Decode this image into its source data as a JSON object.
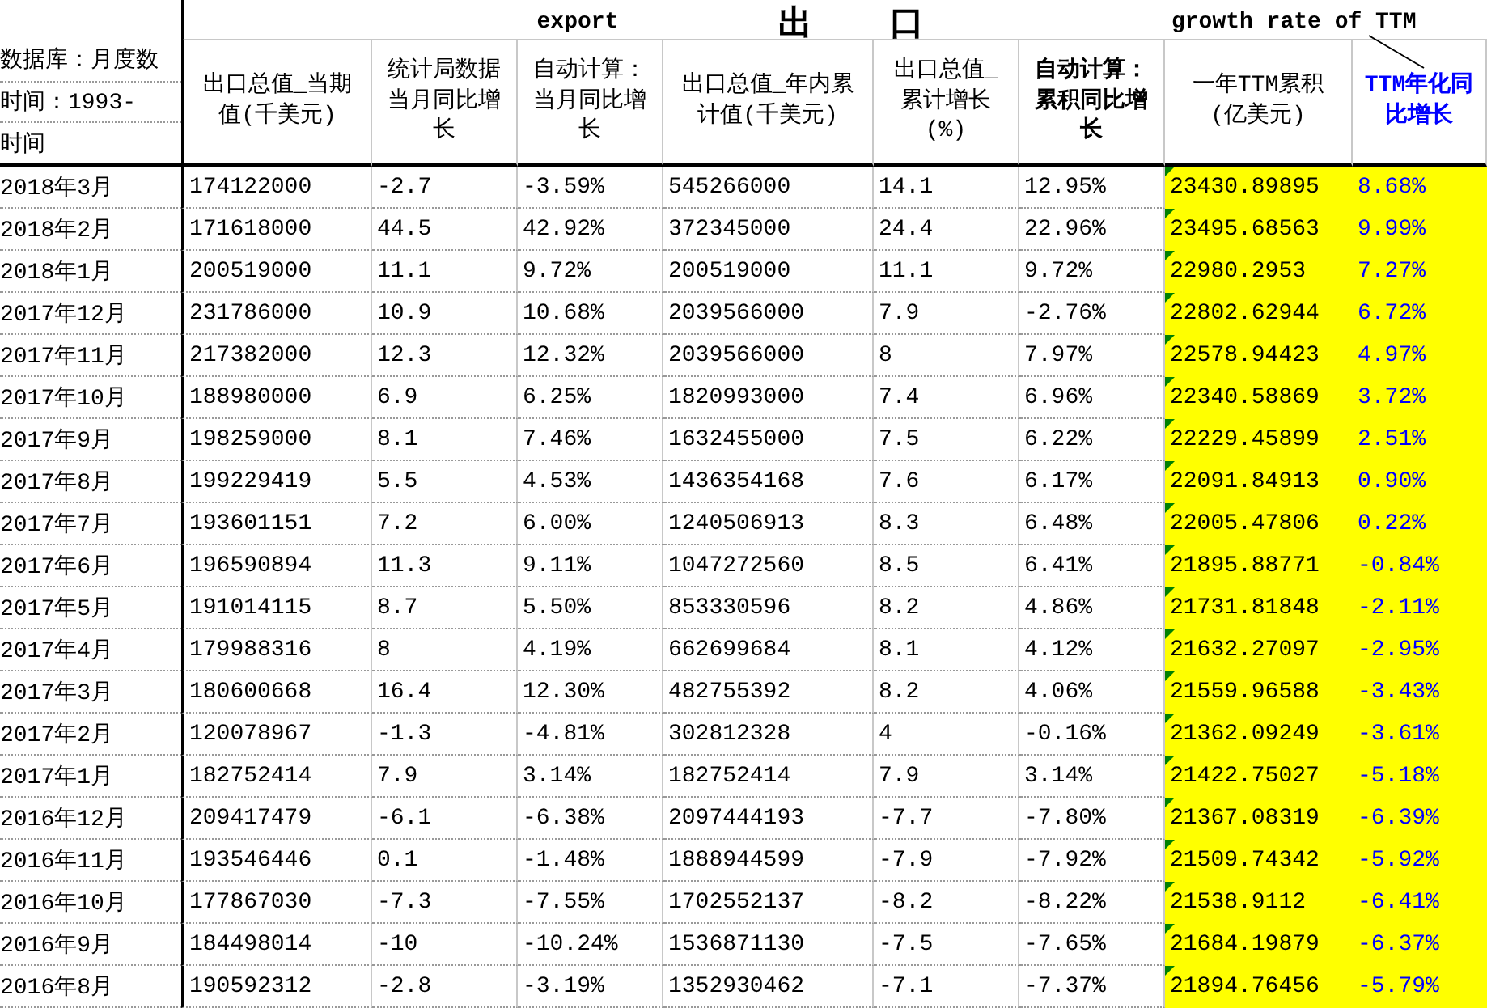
{
  "title_band": {
    "left_label": "export",
    "center_chars": [
      "出",
      "口"
    ],
    "right_label": "growth rate of TTM"
  },
  "side_labels": [
    "数据库：月度数",
    "时间：1993-",
    "时间"
  ],
  "columns": [
    {
      "label": "出口总值_当期值(千美元)"
    },
    {
      "label": "统计局数据当月同比增长"
    },
    {
      "label": "自动计算：当月同比增长"
    },
    {
      "label": "出口总值_年内累计值(千美元)"
    },
    {
      "label": "出口总值_累计增长(%)"
    },
    {
      "label": "自动计算：累积同比增长"
    },
    {
      "label": "一年TTM累积(亿美元)"
    },
    {
      "label": "TTM年化同比增长"
    }
  ],
  "rows": [
    {
      "date": "2018年3月",
      "values": [
        "174122000",
        "-2.7",
        "-3.59%",
        "545266000",
        "14.1",
        "12.95%",
        "23430.89895",
        "8.68%"
      ]
    },
    {
      "date": "2018年2月",
      "values": [
        "171618000",
        "44.5",
        "42.92%",
        "372345000",
        "24.4",
        "22.96%",
        "23495.68563",
        "9.99%"
      ]
    },
    {
      "date": "2018年1月",
      "values": [
        "200519000",
        "11.1",
        "9.72%",
        "200519000",
        "11.1",
        "9.72%",
        "22980.2953",
        "7.27%"
      ]
    },
    {
      "date": "2017年12月",
      "values": [
        "231786000",
        "10.9",
        "10.68%",
        "2039566000",
        "7.9",
        "-2.76%",
        "22802.62944",
        "6.72%"
      ]
    },
    {
      "date": "2017年11月",
      "values": [
        "217382000",
        "12.3",
        "12.32%",
        "2039566000",
        "8",
        "7.97%",
        "22578.94423",
        "4.97%"
      ]
    },
    {
      "date": "2017年10月",
      "values": [
        "188980000",
        "6.9",
        "6.25%",
        "1820993000",
        "7.4",
        "6.96%",
        "22340.58869",
        "3.72%"
      ]
    },
    {
      "date": "2017年9月",
      "values": [
        "198259000",
        "8.1",
        "7.46%",
        "1632455000",
        "7.5",
        "6.22%",
        "22229.45899",
        "2.51%"
      ]
    },
    {
      "date": "2017年8月",
      "values": [
        "199229419",
        "5.5",
        "4.53%",
        "1436354168",
        "7.6",
        "6.17%",
        "22091.84913",
        "0.90%"
      ]
    },
    {
      "date": "2017年7月",
      "values": [
        "193601151",
        "7.2",
        "6.00%",
        "1240506913",
        "8.3",
        "6.48%",
        "22005.47806",
        "0.22%"
      ]
    },
    {
      "date": "2017年6月",
      "values": [
        "196590894",
        "11.3",
        "9.11%",
        "1047272560",
        "8.5",
        "6.41%",
        "21895.88771",
        "-0.84%"
      ]
    },
    {
      "date": "2017年5月",
      "values": [
        "191014115",
        "8.7",
        "5.50%",
        "853330596",
        "8.2",
        "4.86%",
        "21731.81848",
        "-2.11%"
      ]
    },
    {
      "date": "2017年4月",
      "values": [
        "179988316",
        "8",
        "4.19%",
        "662699684",
        "8.1",
        "4.12%",
        "21632.27097",
        "-2.95%"
      ]
    },
    {
      "date": "2017年3月",
      "values": [
        "180600668",
        "16.4",
        "12.30%",
        "482755392",
        "8.2",
        "4.06%",
        "21559.96588",
        "-3.43%"
      ]
    },
    {
      "date": "2017年2月",
      "values": [
        "120078967",
        "-1.3",
        "-4.81%",
        "302812328",
        "4",
        "-0.16%",
        "21362.09249",
        "-3.61%"
      ]
    },
    {
      "date": "2017年1月",
      "values": [
        "182752414",
        "7.9",
        "3.14%",
        "182752414",
        "7.9",
        "3.14%",
        "21422.75027",
        "-5.18%"
      ]
    },
    {
      "date": "2016年12月",
      "values": [
        "209417479",
        "-6.1",
        "-6.38%",
        "2097444193",
        "-7.7",
        "-7.80%",
        "21367.08319",
        "-6.39%"
      ]
    },
    {
      "date": "2016年11月",
      "values": [
        "193546446",
        "0.1",
        "-1.48%",
        "1888944599",
        "-7.9",
        "-7.92%",
        "21509.74342",
        "-5.92%"
      ]
    },
    {
      "date": "2016年10月",
      "values": [
        "177867030",
        "-7.3",
        "-7.55%",
        "1702552137",
        "-8.2",
        "-8.22%",
        "21538.9112",
        "-6.41%"
      ]
    },
    {
      "date": "2016年9月",
      "values": [
        "184498014",
        "-10",
        "-10.24%",
        "1536871130",
        "-7.5",
        "-7.65%",
        "21684.19879",
        "-6.37%"
      ]
    },
    {
      "date": "2016年8月",
      "values": [
        "190592312",
        "-2.8",
        "-3.19%",
        "1352930462",
        "-7.1",
        "-7.37%",
        "21894.76456",
        "-5.79%"
      ]
    }
  ]
}
